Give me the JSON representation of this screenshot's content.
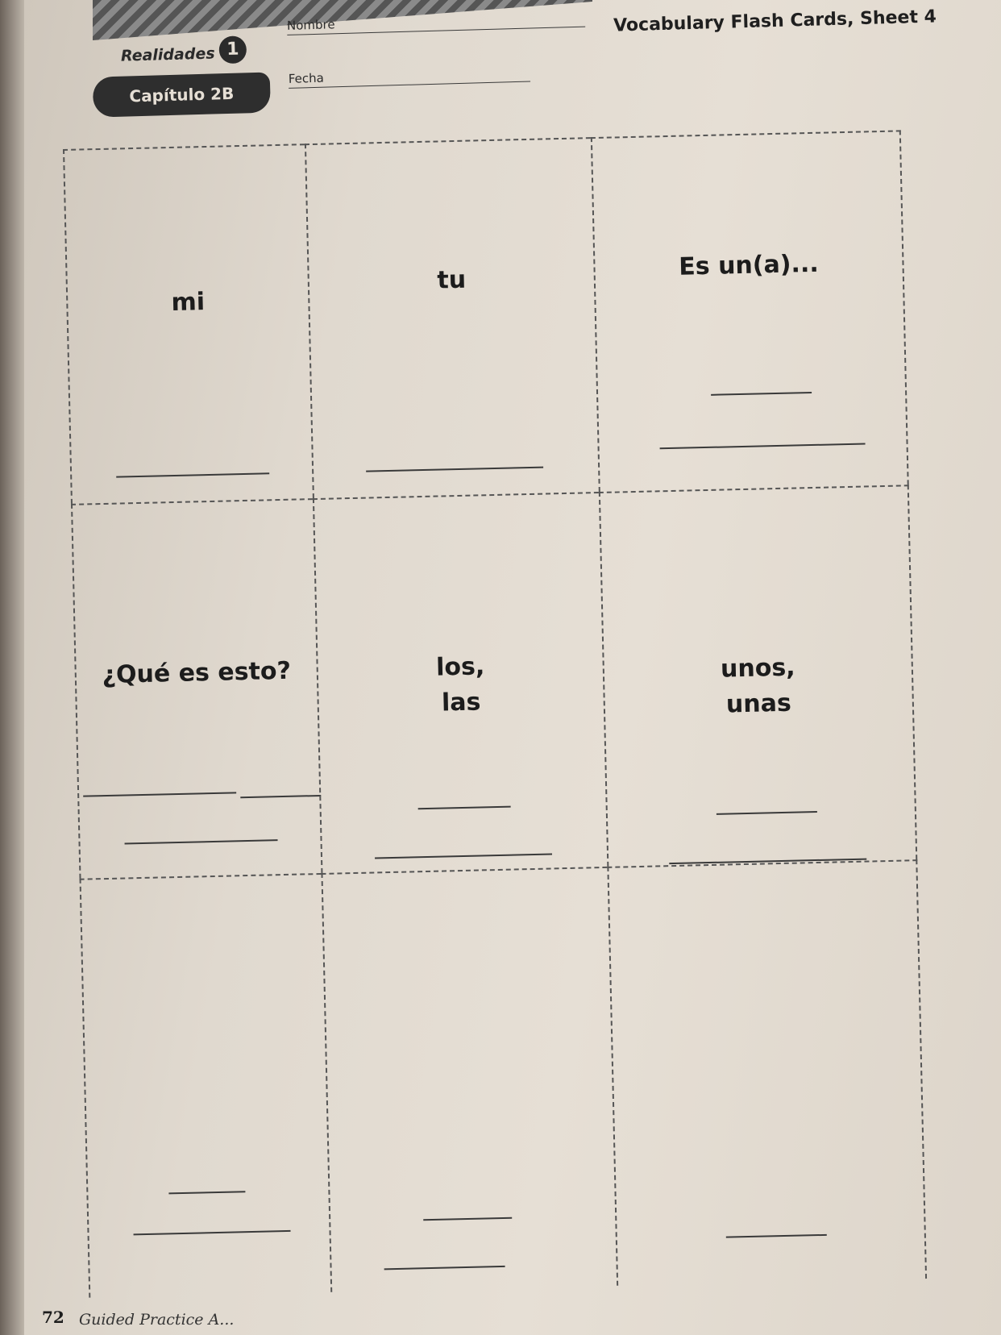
{
  "header": {
    "series": "Realidades",
    "level": "1",
    "chapter": "Capítulo 2B",
    "name_label": "Nombre",
    "date_label": "Fecha",
    "sheet_title": "Vocabulary Flash Cards, Sheet 4"
  },
  "cards": [
    {
      "word": "mi"
    },
    {
      "word": "tu"
    },
    {
      "word": "Es un(a)..."
    },
    {
      "word": "¿Qué es esto?"
    },
    {
      "word": "los,\nlas"
    },
    {
      "word": "unos,\nunas"
    },
    {
      "word": ""
    },
    {
      "word": ""
    },
    {
      "word": ""
    }
  ],
  "footer": {
    "page_number": "72",
    "text": "Guided Practice A..."
  }
}
